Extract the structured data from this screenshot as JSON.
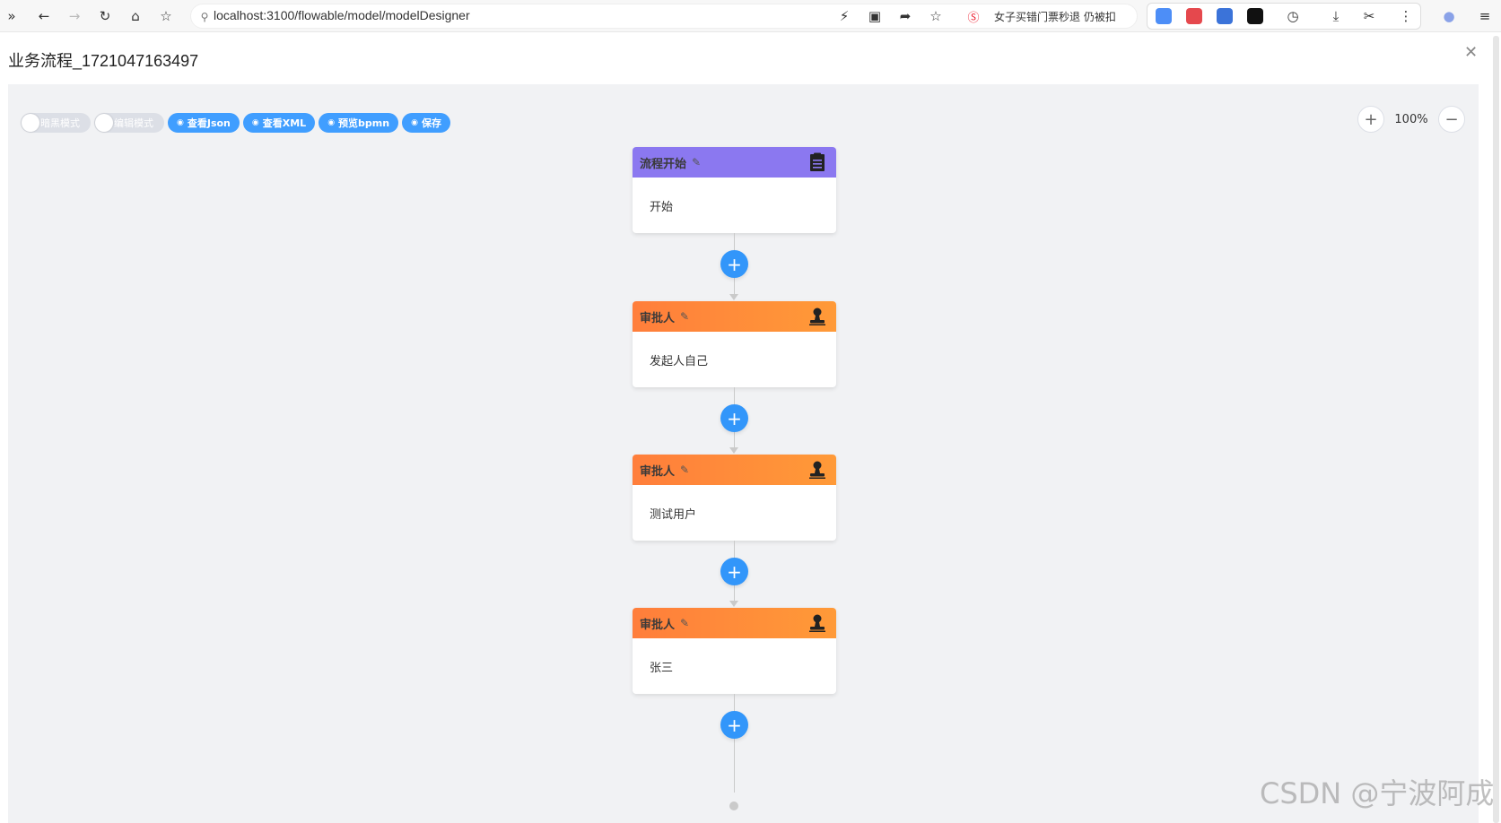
{
  "browser": {
    "url": "localhost:3100/flowable/model/modelDesigner",
    "hot_search": "女子买错门票秒退 仍被扣"
  },
  "page": {
    "title": "业务流程_1721047163497"
  },
  "toolbar": {
    "dark_mode_label": "暗黑模式",
    "edit_mode_label": "编辑模式",
    "view_json_label": "查看Json",
    "view_xml_label": "查看XML",
    "preview_bpmn_label": "预览bpmn",
    "save_label": "保存"
  },
  "zoom": {
    "value": "100%",
    "in_symbol": "+",
    "out_symbol": "−"
  },
  "nodes": [
    {
      "type": "start",
      "header": "流程开始",
      "body": "开始",
      "icon": "clipboard-icon",
      "color": "#8b78f0"
    },
    {
      "type": "approver",
      "header": "审批人",
      "body": "发起人自己",
      "icon": "user-stamp-icon",
      "color": "#ff8a3a"
    },
    {
      "type": "approver",
      "header": "审批人",
      "body": "测试用户",
      "icon": "user-stamp-icon",
      "color": "#ff8a3a"
    },
    {
      "type": "approver",
      "header": "审批人",
      "body": "张三",
      "icon": "user-stamp-icon",
      "color": "#ff8a3a"
    }
  ],
  "add_symbol": "+",
  "watermark": "CSDN @宁波阿成",
  "colors": {
    "accent": "#409eff",
    "add_button": "#3296fa",
    "canvas": "#f1f2f4"
  }
}
